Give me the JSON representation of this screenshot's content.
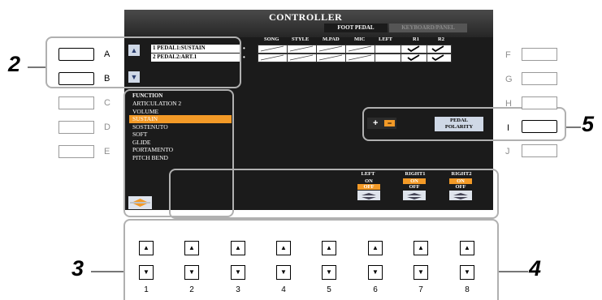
{
  "screen": {
    "title": "CONTROLLER",
    "tabs": [
      {
        "label": "FOOT PEDAL",
        "active": true
      },
      {
        "label": "KEYBOARD/PANEL",
        "active": false
      }
    ],
    "columns": [
      "SONG",
      "STYLE",
      "M.PAD",
      "MIC",
      "LEFT",
      "R1",
      "R2"
    ],
    "pedals": [
      {
        "label": "1  PEDAL1:SUSTAIN",
        "marker": "•",
        "checked": [
          "R1",
          "R2"
        ]
      },
      {
        "label": "2  PEDAL2:ART.1",
        "marker": "•",
        "checked": [
          "R1",
          "R2"
        ]
      }
    ],
    "function_header": "FUNCTION",
    "functions": [
      "ARTICULATION 2",
      "VOLUME",
      "SUSTAIN",
      "SOSTENUTO",
      "SOFT",
      "GLIDE",
      "PORTAMENTO",
      "PITCH BEND"
    ],
    "selected_function": "SUSTAIN",
    "polarity": {
      "plus": "+",
      "minus": "−",
      "button_line1": "PEDAL",
      "button_line2": "POLARITY"
    },
    "parts": [
      {
        "name": "LEFT",
        "on": "ON",
        "off": "OFF",
        "state": "OFF"
      },
      {
        "name": "RIGHT1",
        "on": "ON",
        "off": "OFF",
        "state": "ON"
      },
      {
        "name": "RIGHT2",
        "on": "ON",
        "off": "OFF",
        "state": "ON"
      }
    ]
  },
  "left_buttons": [
    "A",
    "B",
    "C",
    "D",
    "E"
  ],
  "right_buttons": [
    "F",
    "G",
    "H",
    "I",
    "J"
  ],
  "dial_numbers": [
    "1",
    "2",
    "3",
    "4",
    "5",
    "6",
    "7",
    "8"
  ],
  "dial_up_glyph": "▲",
  "dial_down_glyph": "▼",
  "callouts": [
    "2",
    "3",
    "4",
    "5"
  ],
  "colors": {
    "accent": "#f39a27",
    "screen_bg": "#1b1b1b"
  }
}
